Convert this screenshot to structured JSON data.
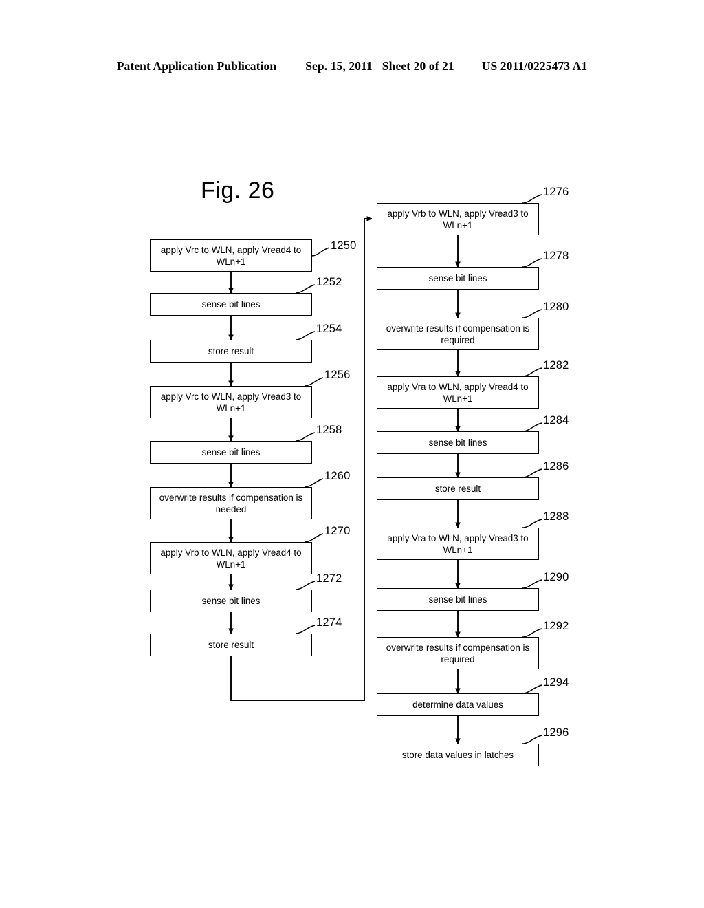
{
  "header": {
    "publication": "Patent Application Publication",
    "date": "Sep. 15, 2011",
    "sheet": "Sheet 20 of 21",
    "patent_number": "US 2011/0225473 A1"
  },
  "figure": {
    "title": "Fig. 26"
  },
  "flowchart": {
    "left_column": [
      {
        "ref": "1250",
        "text": "apply Vrc to WLN, apply Vread4 to WLn+1",
        "lines": 2
      },
      {
        "ref": "1252",
        "text": "sense bit lines",
        "lines": 1
      },
      {
        "ref": "1254",
        "text": "store result",
        "lines": 1
      },
      {
        "ref": "1256",
        "text": "apply Vrc to WLN, apply Vread3 to WLn+1",
        "lines": 2
      },
      {
        "ref": "1258",
        "text": "sense bit lines",
        "lines": 1
      },
      {
        "ref": "1260",
        "text": "overwrite results if compensation is needed",
        "lines": 2
      },
      {
        "ref": "1270",
        "text": "apply Vrb to WLN, apply Vread4 to WLn+1",
        "lines": 2
      },
      {
        "ref": "1272",
        "text": "sense bit lines",
        "lines": 1
      },
      {
        "ref": "1274",
        "text": "store result",
        "lines": 1
      }
    ],
    "right_column": [
      {
        "ref": "1276",
        "text": "apply Vrb to WLN, apply Vread3 to WLn+1",
        "lines": 2
      },
      {
        "ref": "1278",
        "text": "sense bit lines",
        "lines": 1
      },
      {
        "ref": "1280",
        "text": "overwrite results if compensation is required",
        "lines": 2
      },
      {
        "ref": "1282",
        "text": "apply Vra to WLN, apply Vread4 to WLn+1",
        "lines": 2
      },
      {
        "ref": "1284",
        "text": "sense bit lines",
        "lines": 1
      },
      {
        "ref": "1286",
        "text": "store result",
        "lines": 1
      },
      {
        "ref": "1288",
        "text": "apply Vra to WLN, apply Vread3 to WLn+1",
        "lines": 2
      },
      {
        "ref": "1290",
        "text": "sense bit lines",
        "lines": 1
      },
      {
        "ref": "1292",
        "text": "overwrite results if compensation is required",
        "lines": 2
      },
      {
        "ref": "1294",
        "text": "determine data values",
        "lines": 1
      },
      {
        "ref": "1296",
        "text": "store data values in latches",
        "lines": 1
      }
    ]
  }
}
